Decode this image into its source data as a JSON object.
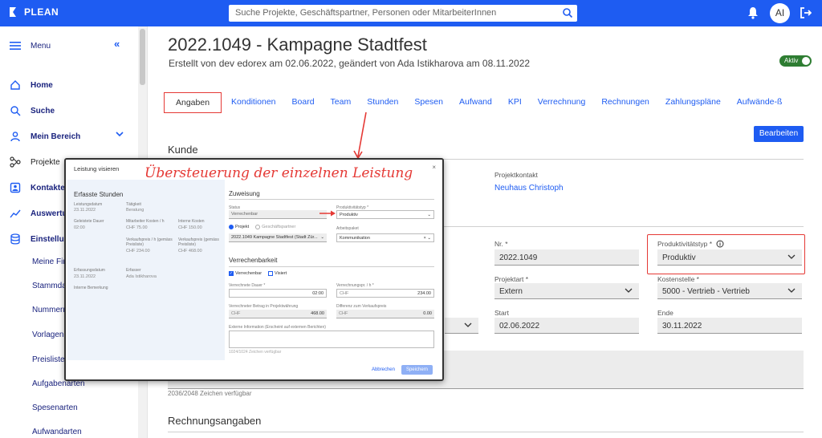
{
  "header": {
    "logo_text": "PLEAN",
    "search_placeholder": "Suche Projekte, Geschäftspartner, Personen oder MitarbeiterInnen",
    "avatar_initials": "AI"
  },
  "sidebar": {
    "menu_label": "Menu",
    "items": [
      {
        "label": "Home"
      },
      {
        "label": "Suche"
      },
      {
        "label": "Mein Bereich"
      },
      {
        "label": "Projekte"
      },
      {
        "label": "Kontakte"
      },
      {
        "label": "Auswertu"
      },
      {
        "label": "Einstellur"
      }
    ],
    "sub_items": [
      "Meine Fir",
      "Stammda",
      "Nummern",
      "Vorlagen",
      "Preisliste",
      "Aufgabenarten",
      "Spesenarten",
      "Aufwandarten"
    ]
  },
  "project": {
    "title": "2022.1049 - Kampagne Stadtfest",
    "subtitle": "Erstellt von dev edorex am 02.06.2022, geändert von Ada Istikharova am 08.11.2022",
    "status_toggle": "Aktiv"
  },
  "tabs": [
    "Angaben",
    "Konditionen",
    "Board",
    "Team",
    "Stunden",
    "Spesen",
    "Aufwand",
    "KPI",
    "Verrechnung",
    "Rechnungen",
    "Zahlungspläne",
    "Aufwände-ß"
  ],
  "edit_button": "Bearbeiten",
  "kunde": {
    "section_title": "Kunde",
    "projektkontakt_label": "Projektkontakt",
    "projektkontakt_value": "Neuhaus Christoph"
  },
  "fields": {
    "nr_label": "Nr. *",
    "nr_value": "2022.1049",
    "produktivitaetstyp_label": "Produktivitätstyp *",
    "produktivitaetstyp_value": "Produktiv",
    "projektart_label": "Projektart *",
    "projektart_value": "Extern",
    "kostenstelle_label": "Kostenstelle *",
    "kostenstelle_value": "5000 - Vertrieb - Vertrieb",
    "start_label": "Start",
    "start_value": "02.06.2022",
    "ende_label": "Ende",
    "ende_value": "30.11.2022",
    "chars_remaining": "2036/2048 Zeichen verfügbar"
  },
  "rechnungsangaben_title": "Rechnungsangaben",
  "annotation": "Übersteuerung der einzelnen Leistung",
  "modal": {
    "title": "Leistung visieren",
    "left": {
      "section": "Erfasste Stunden",
      "leistungsdatum_label": "Leistungsdatum",
      "leistungsdatum": "23.11.2022",
      "taetigkeit_label": "Tätigkeit",
      "taetigkeit": "Beratung",
      "dauer_label": "Geleistete Dauer",
      "dauer": "02:00",
      "mk_label": "Mitarbeiter Kosten / h",
      "mk": "CHF 75.00",
      "ik_label": "Interne Kosten",
      "ik": "CHF 150.00",
      "vp_h_label": "Verkaufspreis / h (gemäss Preisliste)",
      "vp_h": "CHF 234.00",
      "vp_label": "Verkaufspreis (gemäss Preisliste)",
      "vp": "CHF 468.00",
      "erfassungsdatum_label": "Erfassungsdatum",
      "erfassungsdatum": "23.11.2022",
      "erfasser_label": "Erfasser",
      "erfasser": "Ada Istikharova",
      "bemerkung_label": "Interne Bemerkung"
    },
    "right": {
      "zuweisung": "Zuweisung",
      "status_label": "Status",
      "status": "Verrechenbar",
      "prod_label": "Produktivitätstyp *",
      "prod": "Produktiv",
      "radio_projekt": "Projekt",
      "radio_gp": "Geschäftspartner",
      "arbeitspaket_label": "Arbeitspaket",
      "projekt_value": "2022.1049 Kampagne Stadtfest (Stadt Zür...",
      "arbeitspaket_value": "Kommunikation",
      "verrechenbarkeit": "Verrechenbarkeit",
      "cb_verrechenbar": "Verrechenbar",
      "cb_visiert": "Visiert",
      "vd_label": "Verrechnete Dauer *",
      "vd": "02:00",
      "vp_label": "Verrechnungspr. / h *",
      "vp_cur": "CHF",
      "vp": "234.00",
      "vb_label": "Verrechneter Betrag in Projektwährung",
      "vb_cur": "CHF",
      "vb": "468.00",
      "diff_label": "Differenz zum Verkaufspreis",
      "diff_cur": "CHF",
      "diff": "0.00",
      "ext_label": "Externe Information (Erscheint auf externen Berichten)",
      "ext_chars": "1024/1024 Zeichen verfügbar"
    },
    "cancel": "Abbrechen",
    "save": "Speichern"
  },
  "colors": {
    "brand": "#1e5cf2",
    "highlight": "#e53935",
    "active_toggle": "#2e7d32"
  }
}
